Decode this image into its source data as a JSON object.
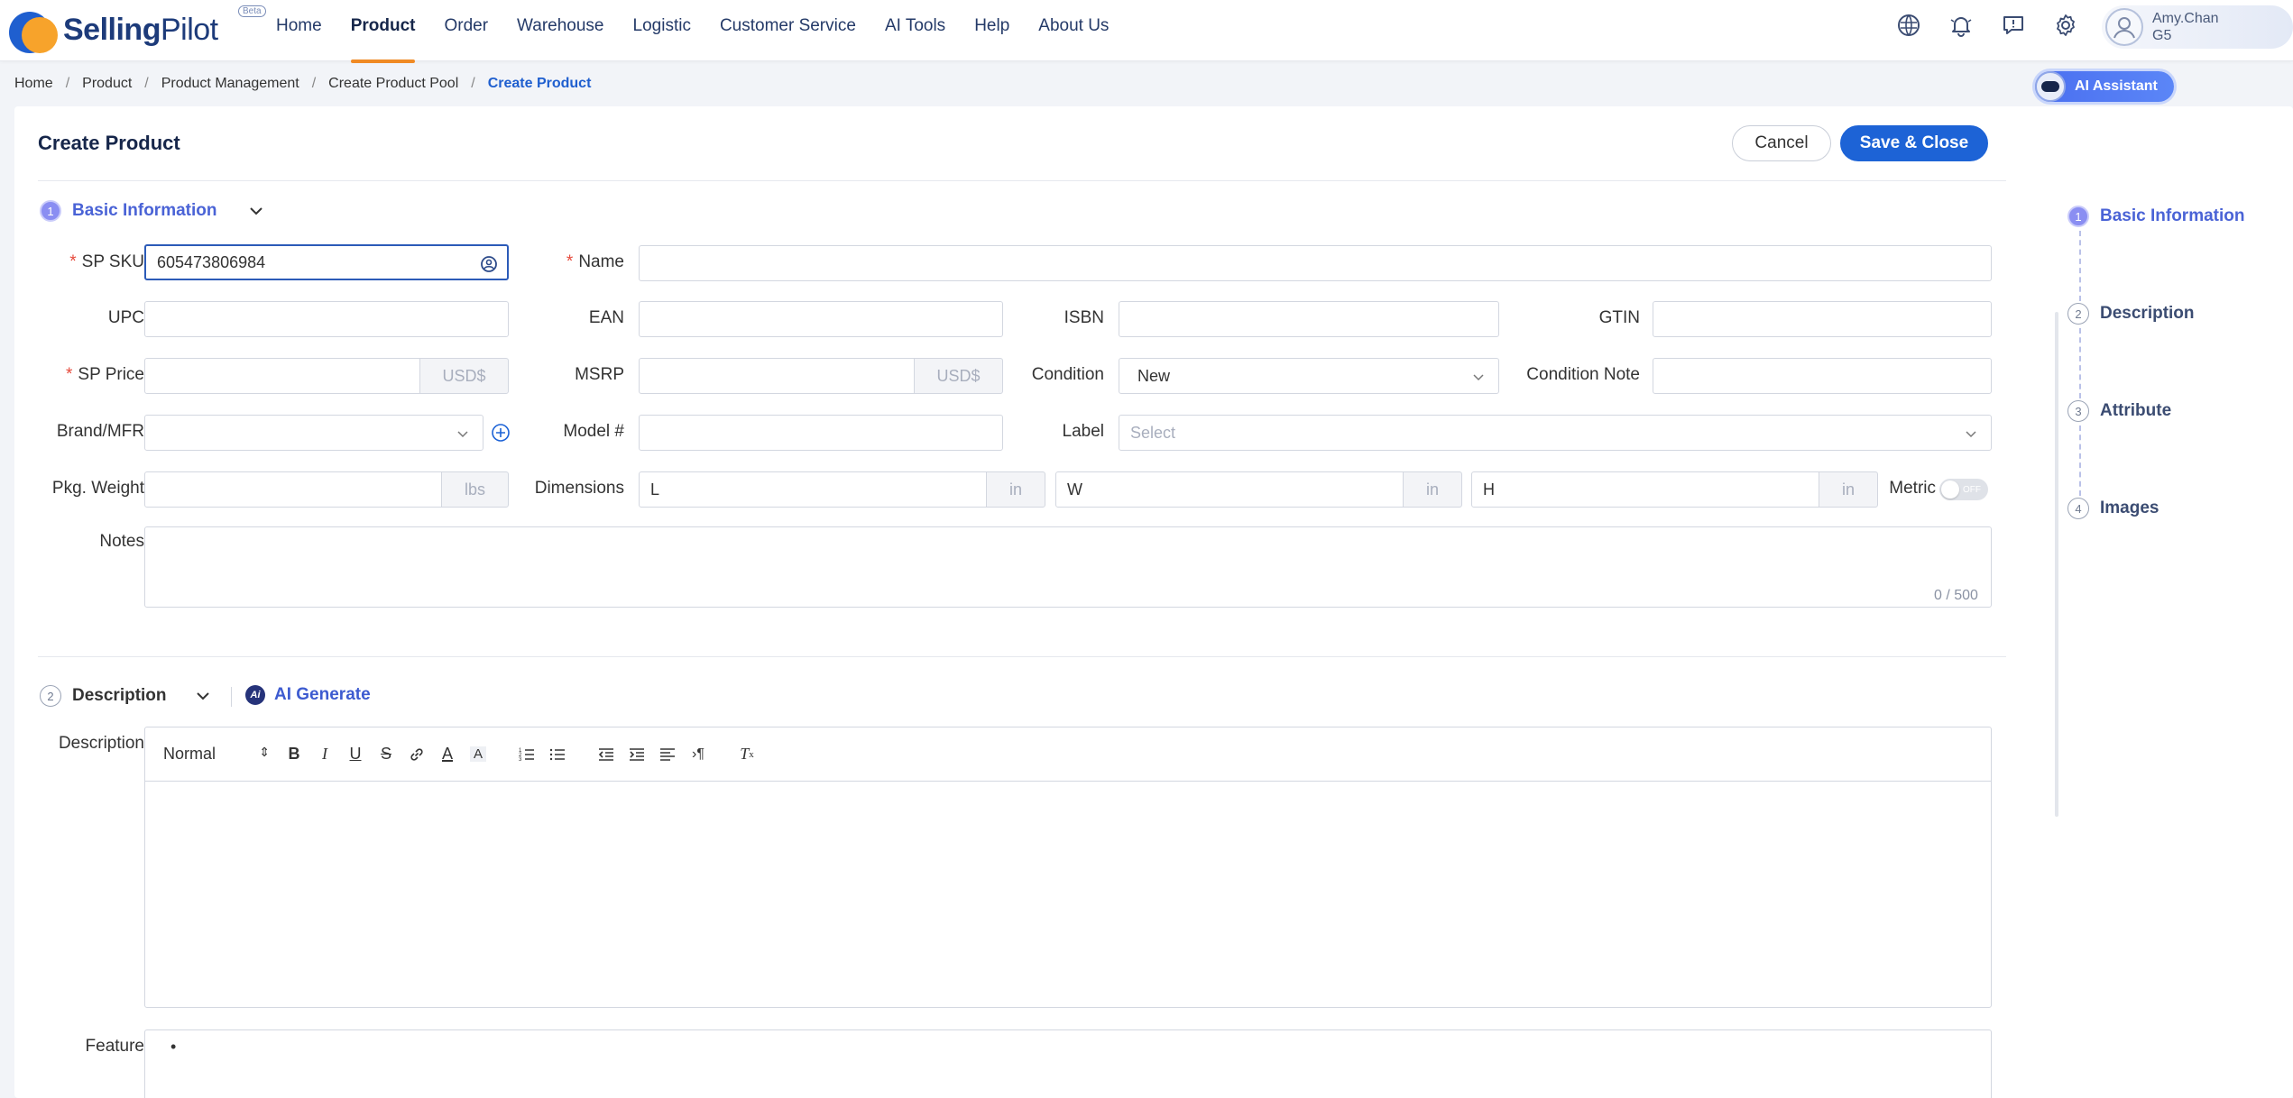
{
  "app": {
    "logo_bold": "Selling",
    "logo_light": "Pilot",
    "logo_badge": "Beta"
  },
  "nav": {
    "items": [
      {
        "label": "Home"
      },
      {
        "label": "Product",
        "active": true
      },
      {
        "label": "Order"
      },
      {
        "label": "Warehouse"
      },
      {
        "label": "Logistic"
      },
      {
        "label": "Customer Service"
      },
      {
        "label": "AI Tools"
      },
      {
        "label": "Help"
      },
      {
        "label": "About Us"
      }
    ]
  },
  "header_icons": [
    "globe-icon",
    "bell-icon",
    "message-icon",
    "gear-icon"
  ],
  "user": {
    "name": "Amy.Chan",
    "org": "G5"
  },
  "breadcrumb": [
    "Home",
    "Product",
    "Product Management",
    "Create Product Pool",
    "Create Product"
  ],
  "ai_assistant_label": "AI Assistant",
  "page": {
    "title": "Create Product",
    "cancel_label": "Cancel",
    "save_label": "Save & Close"
  },
  "sections": {
    "basic": {
      "step": "1",
      "title": "Basic Information"
    },
    "description": {
      "step": "2",
      "title": "Description",
      "ai_generate": "AI Generate",
      "ai_badge": "Ai"
    }
  },
  "form": {
    "sp_sku": {
      "label": "SP SKU",
      "value": "605473806984"
    },
    "name": {
      "label": "Name",
      "value": ""
    },
    "upc": {
      "label": "UPC",
      "value": ""
    },
    "ean": {
      "label": "EAN",
      "value": ""
    },
    "isbn": {
      "label": "ISBN",
      "value": ""
    },
    "gtin": {
      "label": "GTIN",
      "value": ""
    },
    "sp_price": {
      "label": "SP Price",
      "value": "",
      "currency": "USD$"
    },
    "msrp": {
      "label": "MSRP",
      "value": "",
      "currency": "USD$"
    },
    "condition": {
      "label": "Condition",
      "value": "New"
    },
    "condition_note": {
      "label": "Condition Note",
      "value": ""
    },
    "brand": {
      "label": "Brand/MFR",
      "value": ""
    },
    "model": {
      "label": "Model #",
      "value": ""
    },
    "label": {
      "label": "Label",
      "placeholder": "Select"
    },
    "pkg_weight": {
      "label": "Pkg. Weight",
      "value": "",
      "unit": "lbs"
    },
    "dimensions": {
      "label": "Dimensions",
      "l": "L",
      "w": "W",
      "h": "H",
      "unit": "in"
    },
    "metric": {
      "label": "Metric",
      "toggle": "OFF"
    },
    "notes": {
      "label": "Notes",
      "counter": "0 / 500"
    }
  },
  "description_editor": {
    "label": "Description",
    "format": "Normal",
    "feature_label": "Feature",
    "feature_bullet": "•"
  },
  "steps_rail": [
    {
      "num": "1",
      "label": "Basic Information",
      "active": true
    },
    {
      "num": "2",
      "label": "Description"
    },
    {
      "num": "3",
      "label": "Attribute"
    },
    {
      "num": "4",
      "label": "Images"
    }
  ],
  "colors": {
    "primary": "#1d63d6",
    "accent": "#f08a24",
    "active_step": "#4a63d6",
    "required": "#e64a3c"
  }
}
